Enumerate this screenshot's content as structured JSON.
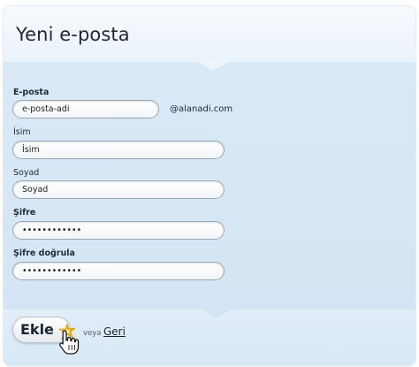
{
  "header": {
    "title": "Yeni e-posta"
  },
  "form": {
    "email": {
      "label": "E-posta",
      "value": "e-posta-adi",
      "domain": "@alanadi.com"
    },
    "first_name": {
      "label": "İsim",
      "value": "İsim"
    },
    "last_name": {
      "label": "Soyad",
      "value": "Soyad"
    },
    "password": {
      "label": "Şifre",
      "value": "••••••••••••"
    },
    "password_confirm": {
      "label": "Şifre doğrula",
      "value": "••••••••••••"
    }
  },
  "footer": {
    "add_label": "Ekle",
    "or_text": "veya",
    "back_label": "Geri"
  },
  "icons": {
    "spark": "spark-icon",
    "cursor": "hand-cursor-icon"
  },
  "colors": {
    "panel_bg": "#d9e9f6",
    "text": "#1e2a36",
    "spark": "#f5b800"
  }
}
